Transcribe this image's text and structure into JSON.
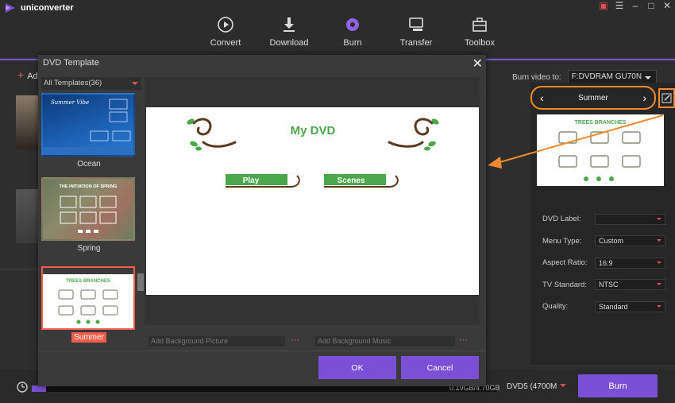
{
  "app": {
    "name": "uniconverter"
  },
  "nav": [
    {
      "label": "Convert",
      "icon": "convert-icon"
    },
    {
      "label": "Download",
      "icon": "download-icon"
    },
    {
      "label": "Burn",
      "icon": "burn-icon",
      "active": true
    },
    {
      "label": "Transfer",
      "icon": "transfer-icon"
    },
    {
      "label": "Toolbox",
      "icon": "toolbox-icon"
    }
  ],
  "main": {
    "add_label": "Ad"
  },
  "burn_to": {
    "label": "Burn video to:",
    "value": "F:DVDRAM GU70N"
  },
  "template_switch": {
    "current": "Summer"
  },
  "right_preview": {
    "title": "TREES BRANCHES"
  },
  "props": {
    "dvd_label": {
      "label": "DVD Label:",
      "value": ""
    },
    "menu_type": {
      "label": "Menu Type:",
      "value": "Custom"
    },
    "aspect_ratio": {
      "label": "Aspect Ratio:",
      "value": "16:9"
    },
    "tv_standard": {
      "label": "TV Standard:",
      "value": "NTSC"
    },
    "quality": {
      "label": "Quality:",
      "value": "Standard"
    }
  },
  "bottom": {
    "progress_text": "0.19GB/4.70GB",
    "progress_fraction": 0.03,
    "disc": "DVD5 (4700M",
    "burn_label": "Burn"
  },
  "modal": {
    "title": "DVD Template",
    "filter": "All Templates(36)",
    "templates": [
      {
        "name": "Ocean",
        "thumb_title": "Summer Vibe"
      },
      {
        "name": "Spring",
        "thumb_title": "THE INITIATION OF SPRING"
      },
      {
        "name": "Summer",
        "thumb_title": "TREES BRANCHES",
        "selected": true
      }
    ],
    "preview": {
      "title": "My DVD",
      "play": "Play",
      "scenes": "Scenes"
    },
    "bg_picture_placeholder": "Add Background Picture",
    "bg_music_placeholder": "Add Background Music",
    "ok_label": "OK",
    "cancel_label": "Cancel"
  },
  "colors": {
    "accent": "#7b4fd6",
    "highlight": "#f08a2e",
    "selected": "#f25c4a",
    "leaf": "#4aa84a",
    "branch": "#5a3a1e"
  }
}
